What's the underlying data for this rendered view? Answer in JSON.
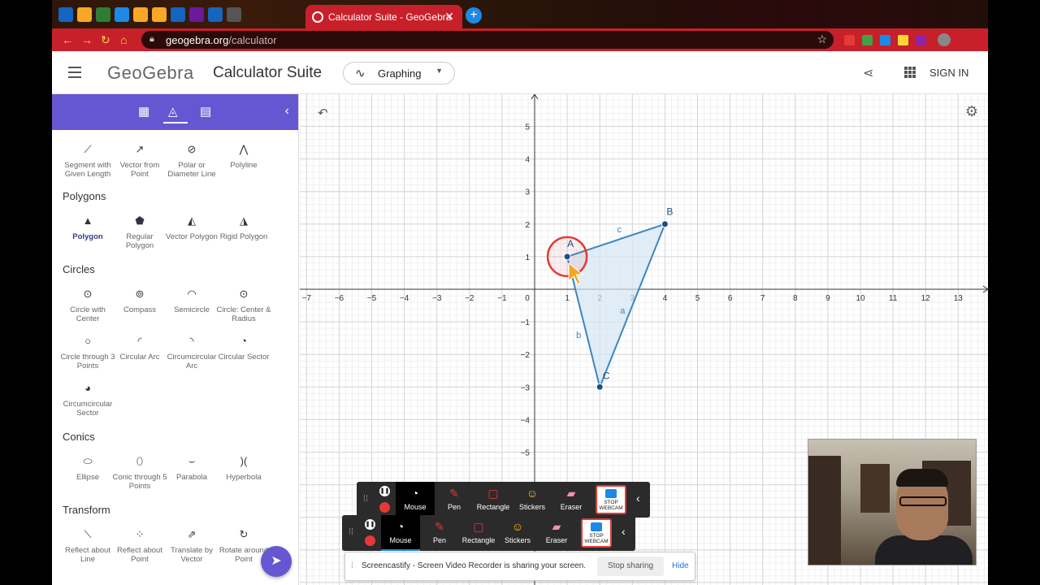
{
  "browser": {
    "active_tab_title": "Calculator Suite - GeoGebra",
    "close_tab_glyph": "✕",
    "new_tab_glyph": "+",
    "url_domain": "geogebra.org",
    "url_path": "/calculator",
    "favicon_colors": [
      "#1565c0",
      "#f9a825",
      "#2e7d32",
      "#1e88e5",
      "#f9a825",
      "#f9a825",
      "#1565c0",
      "#6a1b9a",
      "#1565c0",
      "#555555"
    ],
    "extension_colors": [
      "#e53935",
      "#43a047",
      "#1e88e5",
      "#fdd835",
      "#8e24aa"
    ]
  },
  "header": {
    "logo": "GeoGebra",
    "suite_title": "Calculator Suite",
    "mode_label": "Graphing",
    "signin_label": "SIGN IN"
  },
  "tools": {
    "top_row": [
      {
        "label": "Segment with Given Length",
        "icon": "segment-length-icon",
        "glyph": "⟋"
      },
      {
        "label": "Vector from Point",
        "icon": "vector-from-point-icon",
        "glyph": "↗"
      },
      {
        "label": "Polar or Diameter Line",
        "icon": "polar-line-icon",
        "glyph": "⊘"
      },
      {
        "label": "Polyline",
        "icon": "polyline-icon",
        "glyph": "⋀"
      }
    ],
    "categories": [
      {
        "name": "Polygons",
        "items": [
          {
            "label": "Polygon",
            "icon": "polygon-icon",
            "glyph": "▲",
            "selected": true
          },
          {
            "label": "Regular Polygon",
            "icon": "regular-polygon-icon",
            "glyph": "⬟"
          },
          {
            "label": "Vector Polygon",
            "icon": "vector-polygon-icon",
            "glyph": "◭"
          },
          {
            "label": "Rigid Polygon",
            "icon": "rigid-polygon-icon",
            "glyph": "◮"
          }
        ]
      },
      {
        "name": "Circles",
        "items": [
          {
            "label": "Circle with Center",
            "icon": "circle-center-icon",
            "glyph": "⊙"
          },
          {
            "label": "Compass",
            "icon": "compass-icon",
            "glyph": "⊚"
          },
          {
            "label": "Semicircle",
            "icon": "semicircle-icon",
            "glyph": "◠"
          },
          {
            "label": "Circle: Center & Radius",
            "icon": "circle-radius-icon",
            "glyph": "⊙"
          },
          {
            "label": "Circle through 3 Points",
            "icon": "circle-3-points-icon",
            "glyph": "○"
          },
          {
            "label": "Circular Arc",
            "icon": "circular-arc-icon",
            "glyph": "◜"
          },
          {
            "label": "Circumcircular Arc",
            "icon": "circumcircular-arc-icon",
            "glyph": "◝"
          },
          {
            "label": "Circular Sector",
            "icon": "circular-sector-icon",
            "glyph": "◔"
          },
          {
            "label": "Circumcircular Sector",
            "icon": "circumcircular-sector-icon",
            "glyph": "◕"
          }
        ]
      },
      {
        "name": "Conics",
        "items": [
          {
            "label": "Ellipse",
            "icon": "ellipse-icon",
            "glyph": "⬭"
          },
          {
            "label": "Conic through 5 Points",
            "icon": "conic-5-points-icon",
            "glyph": "⬯"
          },
          {
            "label": "Parabola",
            "icon": "parabola-icon",
            "glyph": "⌣"
          },
          {
            "label": "Hyperbola",
            "icon": "hyperbola-icon",
            "glyph": ")("
          }
        ]
      },
      {
        "name": "Transform",
        "items": [
          {
            "label": "Reflect about Line",
            "icon": "reflect-line-icon",
            "glyph": "⟍"
          },
          {
            "label": "Reflect about Point",
            "icon": "reflect-point-icon",
            "glyph": "⁘"
          },
          {
            "label": "Translate by Vector",
            "icon": "translate-vector-icon",
            "glyph": "⇗"
          },
          {
            "label": "Rotate around Point",
            "icon": "rotate-point-icon",
            "glyph": "↻"
          }
        ]
      }
    ]
  },
  "graph": {
    "x_ticks": [
      "-7",
      "-6",
      "-5",
      "-4",
      "-3",
      "-2",
      "-1",
      "0",
      "1",
      "2",
      "3",
      "4",
      "5",
      "6",
      "7",
      "8",
      "9",
      "10",
      "11",
      "12",
      "13"
    ],
    "y_ticks": [
      "5",
      "4",
      "3",
      "2",
      "1",
      "-1",
      "-2",
      "-3",
      "-4",
      "-5"
    ],
    "points": [
      {
        "name": "A",
        "x": 1,
        "y": 1
      },
      {
        "name": "B",
        "x": 4,
        "y": 2
      },
      {
        "name": "C",
        "x": 2,
        "y": -3
      }
    ],
    "segments": [
      {
        "name": "a",
        "from": "B",
        "to": "C"
      },
      {
        "name": "b",
        "from": "A",
        "to": "C"
      },
      {
        "name": "c",
        "from": "A",
        "to": "B"
      }
    ],
    "fill_color": "#d4e6f4",
    "line_color": "#3a86c3",
    "point_color": "#1b4f87"
  },
  "screencastify": {
    "tools": [
      {
        "label": "Mouse",
        "icon": "cursor-icon",
        "glyph": "◔"
      },
      {
        "label": "Pen",
        "icon": "pen-icon",
        "glyph": "✎"
      },
      {
        "label": "Rectangle",
        "icon": "rectangle-icon",
        "glyph": "▢"
      },
      {
        "label": "Stickers",
        "icon": "sticker-icon",
        "glyph": "☺"
      },
      {
        "label": "Eraser",
        "icon": "eraser-icon",
        "glyph": "▰"
      }
    ],
    "webcam_line1": "STOP",
    "webcam_line2": "WEBCAM",
    "sharing_message": "Screencastify - Screen Video Recorder is sharing your screen.",
    "stop_sharing": "Stop sharing",
    "hide": "Hide"
  }
}
